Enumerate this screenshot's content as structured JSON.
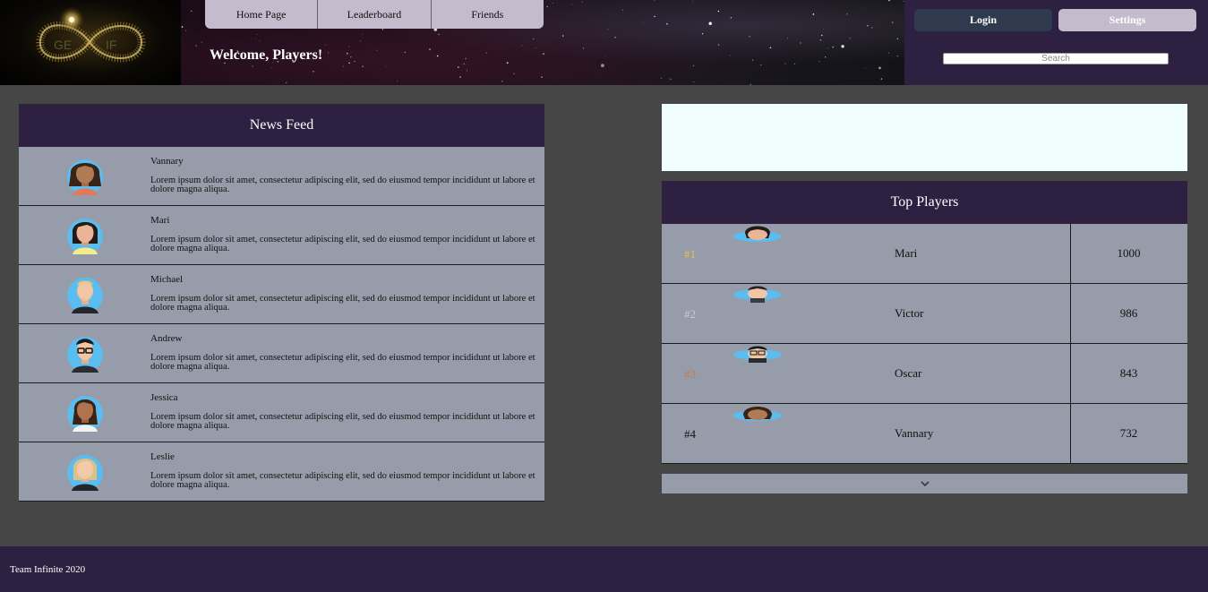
{
  "header": {
    "nav": [
      "Home Page",
      "Leaderboard",
      "Friends"
    ],
    "welcome": "Welcome, Players!",
    "login_label": "Login",
    "settings_label": "Settings",
    "search_placeholder": "Search"
  },
  "news_feed": {
    "title": "News Feed",
    "items": [
      {
        "name": "Vannary",
        "text": "Lorem ipsum dolor sit amet, consectetur adipiscing elit, sed do eiusmod tempor incididunt ut labore et dolore magna aliqua."
      },
      {
        "name": "Mari",
        "text": "Lorem ipsum dolor sit amet, consectetur adipiscing elit, sed do eiusmod tempor incididunt ut labore et dolore magna aliqua."
      },
      {
        "name": "Michael",
        "text": "Lorem ipsum dolor sit amet, consectetur adipiscing elit, sed do eiusmod tempor incididunt ut labore et dolore magna aliqua."
      },
      {
        "name": "Andrew",
        "text": "Lorem ipsum dolor sit amet, consectetur adipiscing elit, sed do eiusmod tempor incididunt ut labore et dolore magna aliqua."
      },
      {
        "name": "Jessica",
        "text": "Lorem ipsum dolor sit amet, consectetur adipiscing elit, sed do eiusmod tempor incididunt ut labore et dolore magna aliqua."
      },
      {
        "name": "Leslie",
        "text": "Lorem ipsum dolor sit amet, consectetur adipiscing elit, sed do eiusmod tempor incididunt ut labore et dolore magna aliqua."
      }
    ]
  },
  "top_players": {
    "title": "Top Players",
    "rows": [
      {
        "rank": "#1",
        "name": "Mari",
        "score": "1000",
        "rank_color": "#e6c24a"
      },
      {
        "rank": "#2",
        "name": "Victor",
        "score": "986",
        "rank_color": "#c8ccd4"
      },
      {
        "rank": "#3",
        "name": "Oscar",
        "score": "843",
        "rank_color": "#c8784a"
      },
      {
        "rank": "#4",
        "name": "Vannary",
        "score": "732",
        "rank_color": "#111111"
      }
    ]
  },
  "footer": {
    "text": "Team Infinite 2020"
  },
  "colors": {
    "background": "#464646",
    "panel_header": "#2e2040",
    "panel_body": "#979caa",
    "ad_box": "#f0fffe",
    "nav": "#c4bccc",
    "login_button": "#2f3a4e"
  }
}
